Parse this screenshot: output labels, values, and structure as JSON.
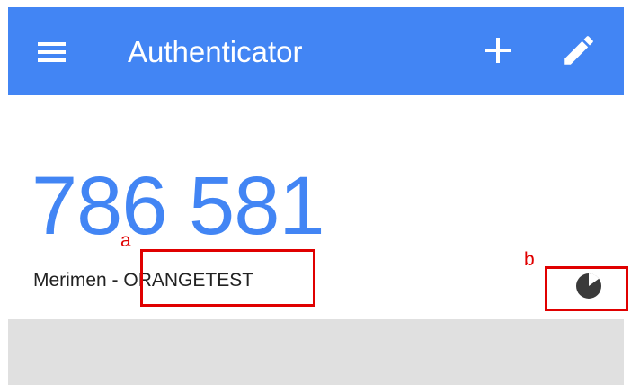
{
  "app_bar": {
    "title": "Authenticator",
    "color": "#4285f4",
    "menu_icon": "menu-icon",
    "add_icon": "plus-icon",
    "edit_icon": "pencil-icon"
  },
  "account": {
    "code": "786 581",
    "issuer": "Merimen",
    "separator": " - ",
    "name": "ORANGETEST",
    "timer_icon": "countdown-timer-icon",
    "code_color": "#4285f4"
  },
  "annotations": {
    "a": "a",
    "b": "b",
    "color": "#e00000"
  }
}
